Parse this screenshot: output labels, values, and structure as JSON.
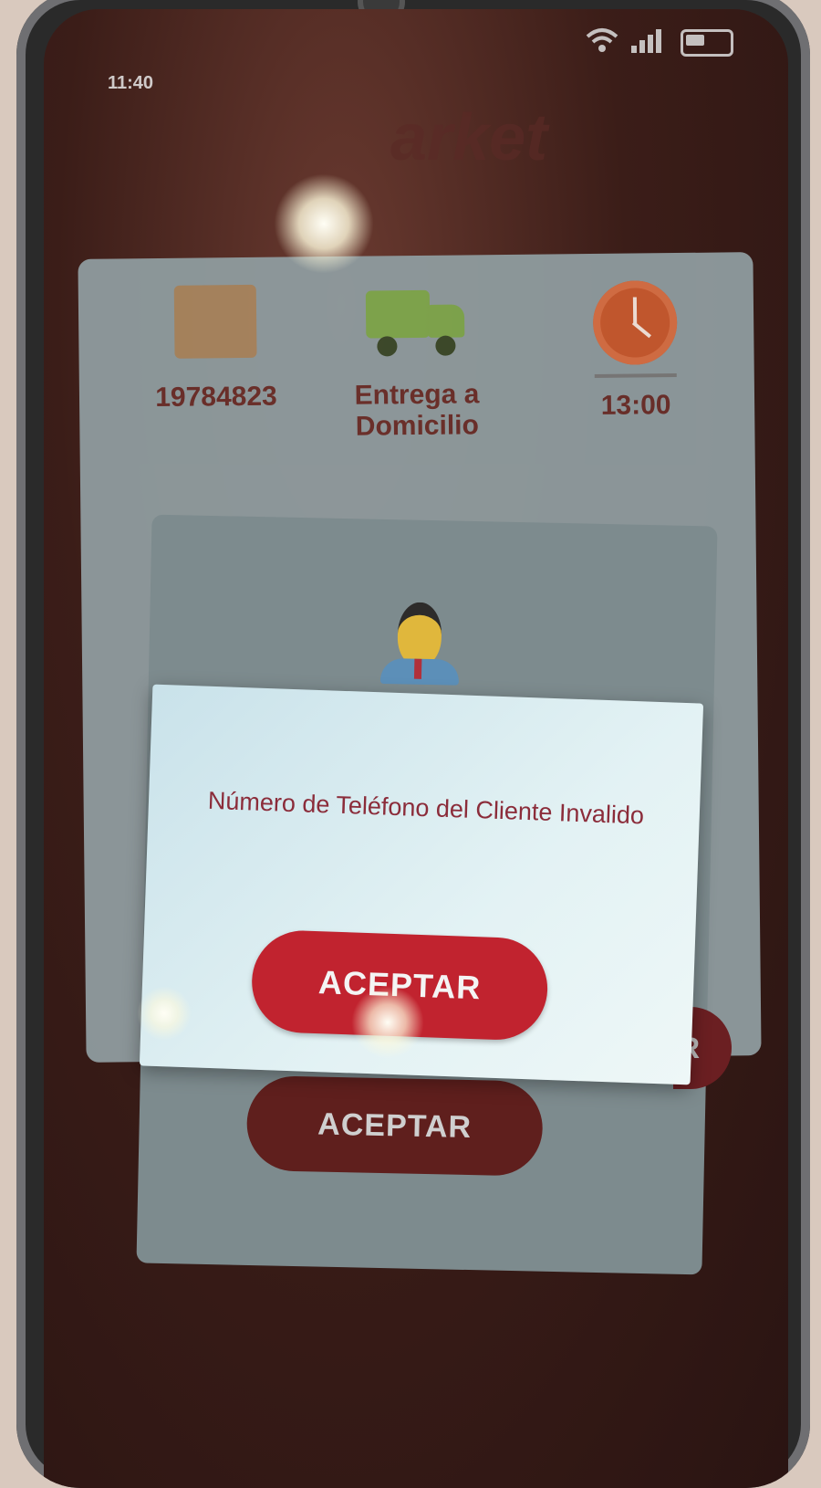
{
  "status_bar": {
    "time": "11:40"
  },
  "app": {
    "logo_text": "arket"
  },
  "order": {
    "id": "19784823",
    "delivery_label": "Entrega a Domicilio",
    "time": "13:00"
  },
  "user_card": {
    "accept_label": "ACEPTAR"
  },
  "dialog": {
    "message": "Número de Teléfono del Cliente Invalido",
    "accept_label": "ACEPTAR"
  },
  "colors": {
    "primary": "#c1232f",
    "message_text": "#8b2c3a",
    "dialog_bg": "#e3f2f4"
  }
}
